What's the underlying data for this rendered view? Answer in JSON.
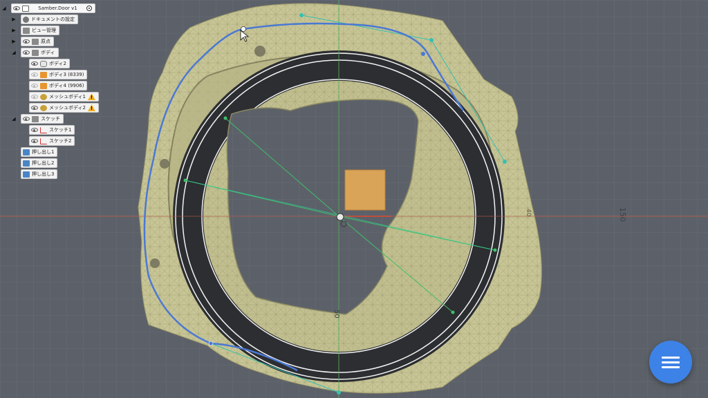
{
  "viewport": {
    "dim_horizontal": "150",
    "dim_vertical": "50",
    "dim_small": "40",
    "colors": {
      "background": "#5b6068",
      "grid": "#666b73",
      "mesh": "#c5c494",
      "ring": "#2e3034",
      "spline": "#4a78d4",
      "axis_x": "#d04a3a",
      "axis_y": "#4aa64a"
    }
  },
  "browser": {
    "root": {
      "label": "Samber.Door v1",
      "icon": "document-icon"
    },
    "items": [
      {
        "label": "ドキュメントの設定",
        "icon": "gear-icon",
        "warning": false
      },
      {
        "label": "ビュー管理",
        "icon": "folder-icon",
        "warning": false
      },
      {
        "label": "原点",
        "icon": "folder-icon",
        "warning": false
      },
      {
        "label": "ボディ",
        "icon": "folder-icon",
        "warning": false
      },
      {
        "label": "ボディ2",
        "icon": "solid-body-icon",
        "warning": false
      },
      {
        "label": "ボディ3 (8339)",
        "icon": "orange-body-icon",
        "warning": false
      },
      {
        "label": "ボディ4 (9906)",
        "icon": "orange-body-icon",
        "warning": false
      },
      {
        "label": "メッシュボディ1",
        "icon": "mesh-body-icon",
        "warning": true
      },
      {
        "label": "メッシュボディ2",
        "icon": "mesh-body-icon",
        "warning": true
      },
      {
        "label": "スケッチ",
        "icon": "folder-icon",
        "warning": false
      },
      {
        "label": "スケッチ1",
        "icon": "sketch-icon",
        "warning": false
      },
      {
        "label": "スケッチ2",
        "icon": "sketch-icon",
        "warning": false
      },
      {
        "label": "押し出し1",
        "icon": "extrude-icon",
        "warning": false
      },
      {
        "label": "押し出し2",
        "icon": "extrude-icon",
        "warning": false
      },
      {
        "label": "押し出し3",
        "icon": "extrude-icon",
        "warning": false
      }
    ],
    "warning_symbol": "!"
  },
  "fab": {
    "icon": "menu-icon"
  }
}
